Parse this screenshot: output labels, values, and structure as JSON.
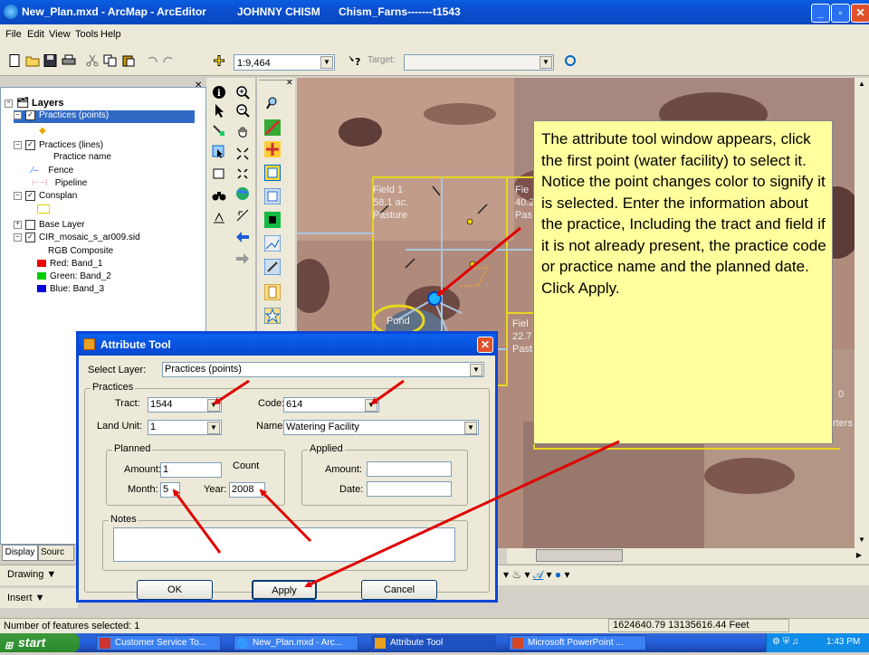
{
  "window": {
    "title": "New_Plan.mxd - ArcMap - ArcEditor",
    "user": "JOHNNY CHISM",
    "farm": "Chism_Farns-------t1543"
  },
  "menu": [
    "File",
    "Edit",
    "View",
    "Tools",
    "Help"
  ],
  "toolbar": {
    "scale": "1:9,464",
    "target_label": "Target:"
  },
  "toc": {
    "root": "Layers",
    "items": [
      "Practices (points)",
      "Practices (lines)",
      "Practice name",
      "Fence",
      "Pipeline",
      "Consplan",
      "Base Layer",
      "CIR_mosaic_s_ar009.sid",
      "RGB Composite",
      "Red:  Band_1",
      "Green: Band_2",
      "Blue:  Band_3"
    ],
    "tabs": [
      "Display",
      "Sourc"
    ]
  },
  "map_labels": {
    "field1": [
      "Field 1",
      "58.1 ac.",
      "Pasture"
    ],
    "field2": [
      "Fie",
      "40.2",
      "Pas"
    ],
    "field3": [
      "Fiel",
      "22.7",
      "Past"
    ],
    "pond": "Pond",
    "right_a": "0",
    "right_b": "rters"
  },
  "callout": "The attribute tool window appears, click the first point (water facility) to select it. Notice the point changes color to signify it is selected. Enter the information about the practice, Including the tract and field if it is not already present, the practice code or practice name and the planned date. Click Apply.",
  "dialog": {
    "title": "Attribute Tool",
    "select_layer_label": "Select Layer:",
    "select_layer_value": "Practices (points)",
    "practices_group": "Practices",
    "tract_label": "Tract:",
    "tract_value": "1544",
    "code_label": "Code:",
    "code_value": "614",
    "land_unit_label": "Land Unit:",
    "land_unit_value": "1",
    "name_label": "Name:",
    "name_value": "Watering Facility",
    "planned_group": "Planned",
    "applied_group": "Applied",
    "amount_label": "Amount:",
    "planned_amount": "1",
    "count_label": "Count",
    "month_label": "Month:",
    "month_value": "5",
    "year_label": "Year:",
    "year_value": "2008",
    "applied_amount_label": "Amount:",
    "date_label": "Date:",
    "notes_label": "Notes",
    "ok": "OK",
    "apply": "Apply",
    "cancel": "Cancel"
  },
  "side_toolbars": {
    "drawing": "Drawing",
    "insert": "Insert"
  },
  "status": {
    "features": "Number of features selected: 1",
    "coords": "1624640.79 13135616.44 Feet"
  },
  "taskbar": {
    "start": "start",
    "tasks": [
      "Customer Service To...",
      "New_Plan.mxd - Arc...",
      "Attribute Tool",
      "Microsoft PowerPoint ..."
    ],
    "clock": "1:43 PM"
  }
}
